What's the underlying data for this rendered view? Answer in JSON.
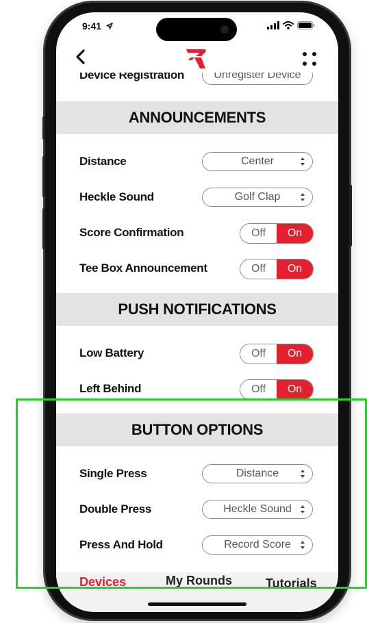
{
  "status": {
    "time": "9:41"
  },
  "top_row": {
    "label": "Device Registration",
    "button": "Unregister Device"
  },
  "announcements": {
    "header": "ANNOUNCEMENTS",
    "distance": {
      "label": "Distance",
      "value": "Center"
    },
    "heckle": {
      "label": "Heckle Sound",
      "value": "Golf Clap"
    },
    "score_confirmation": {
      "label": "Score Confirmation",
      "off": "Off",
      "on": "On"
    },
    "tee_box": {
      "label": "Tee Box Announcement",
      "off": "Off",
      "on": "On"
    }
  },
  "push": {
    "header": "PUSH NOTIFICATIONS",
    "low_battery": {
      "label": "Low Battery",
      "off": "Off",
      "on": "On"
    },
    "left_behind": {
      "label": "Left Behind",
      "off": "Off",
      "on": "On"
    }
  },
  "buttons": {
    "header": "BUTTON OPTIONS",
    "single": {
      "label": "Single Press",
      "value": "Distance"
    },
    "double": {
      "label": "Double Press",
      "value": "Heckle Sound"
    },
    "hold": {
      "label": "Press And Hold",
      "value": "Record Score"
    }
  },
  "tabs": {
    "devices": "Devices",
    "rounds": "My Rounds",
    "tutorials": "Tutorials"
  },
  "colors": {
    "accent": "#e4202f",
    "highlight": "#22d322",
    "header_bg": "#e3e3e3"
  }
}
